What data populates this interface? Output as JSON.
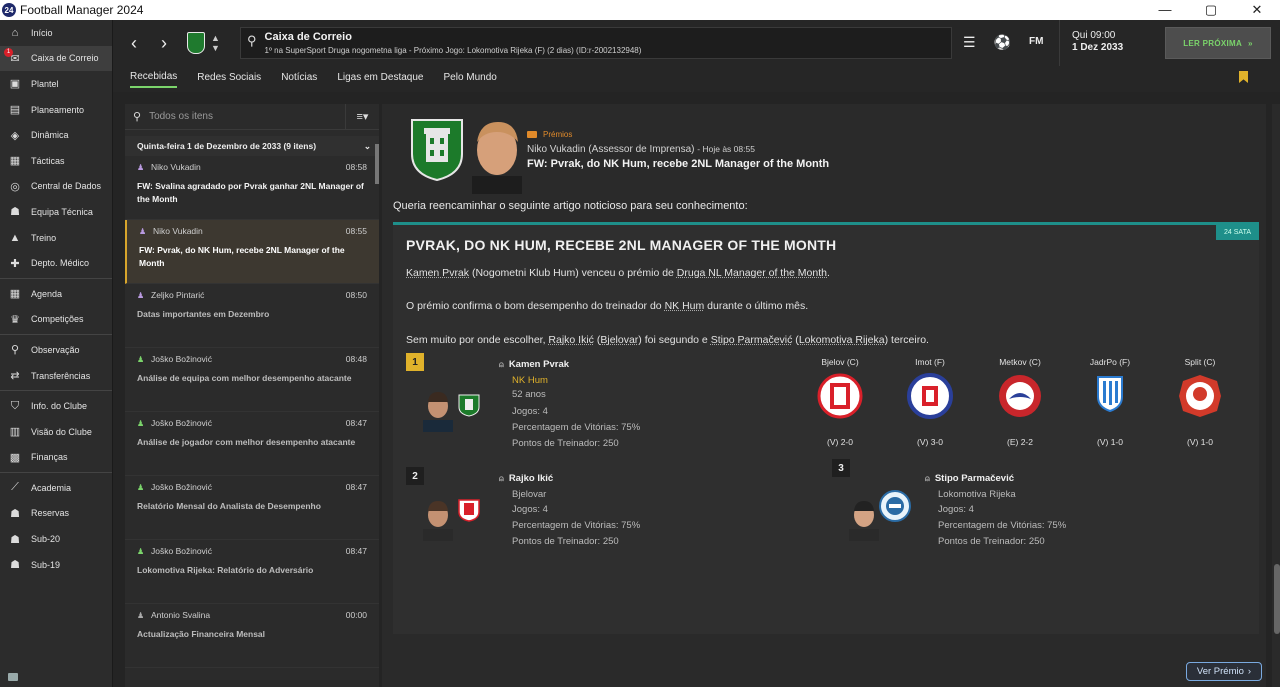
{
  "window": {
    "app_icon": "24",
    "title": "Football Manager 2024",
    "min": "—",
    "max": "▢",
    "close": "✕"
  },
  "sidebar": {
    "mail_badge": "1",
    "items": [
      {
        "label": "Início",
        "icon": "home-icon"
      },
      {
        "label": "Caixa de Correio",
        "icon": "mail-icon"
      },
      {
        "label": "Plantel",
        "icon": "shirt-icon"
      },
      {
        "label": "Planeamento",
        "icon": "clipboard-icon"
      },
      {
        "label": "Dinâmica",
        "icon": "dynamics-icon"
      },
      {
        "label": "Tácticas",
        "icon": "tactics-icon"
      },
      {
        "label": "Central de Dados",
        "icon": "data-icon"
      },
      {
        "label": "Equipa Técnica",
        "icon": "staff-icon"
      },
      {
        "label": "Treino",
        "icon": "training-icon"
      },
      {
        "label": "Depto. Médico",
        "icon": "medical-icon"
      },
      {
        "label": "Agenda",
        "icon": "calendar-icon"
      },
      {
        "label": "Competições",
        "icon": "trophy-icon"
      },
      {
        "label": "Observação",
        "icon": "scouting-icon"
      },
      {
        "label": "Transferências",
        "icon": "transfer-icon"
      },
      {
        "label": "Info. do Clube",
        "icon": "shield-icon"
      },
      {
        "label": "Visão do Clube",
        "icon": "vision-icon"
      },
      {
        "label": "Finanças",
        "icon": "finance-icon"
      },
      {
        "label": "Academia",
        "icon": "academy-icon"
      },
      {
        "label": "Reservas",
        "icon": "reserves-icon"
      },
      {
        "label": "Sub-20",
        "icon": "u20-icon"
      },
      {
        "label": "Sub-19",
        "icon": "u19-icon"
      }
    ]
  },
  "topbar": {
    "title": "Caixa de Correio",
    "subtitle": "1º na SuperSport Druga nogometna liga - Próximo Jogo: Lokomotiva Rijeka (F) (2 dias) (ID:r-2002132948)",
    "fm_label": "FM",
    "date_day": "Qui 09:00",
    "date_full": "1 Dez 2033",
    "next_button": "LER PRÓXIMA"
  },
  "tabs": [
    "Recebidas",
    "Redes Sociais",
    "Notícias",
    "Ligas em Destaque",
    "Pelo Mundo"
  ],
  "list": {
    "search_placeholder": "Todos os itens",
    "group_label": "Quinta-feira 1 de Dezembro de 2033 (9 itens)",
    "messages": [
      {
        "from": "Niko Vukadin",
        "time": "08:58",
        "subject": "FW: Svalina agradado por Pvrak ganhar 2NL Manager of the Month"
      },
      {
        "from": "Niko Vukadin",
        "time": "08:55",
        "subject": "FW: Pvrak, do NK Hum, recebe 2NL Manager of the Month"
      },
      {
        "from": "Zeljko Pintarić",
        "time": "08:50",
        "subject": "Datas importantes em Dezembro"
      },
      {
        "from": "Joško Božinović",
        "time": "08:48",
        "subject": "Análise de equipa com melhor desempenho atacante"
      },
      {
        "from": "Joško Božinović",
        "time": "08:47",
        "subject": "Análise de jogador com melhor desempenho atacante"
      },
      {
        "from": "Joško Božinović",
        "time": "08:47",
        "subject": "Relatório Mensal do Analista de Desempenho"
      },
      {
        "from": "Joško Božinović",
        "time": "08:47",
        "subject": "Lokomotiva Rijeka: Relatório do Adversário"
      },
      {
        "from": "Antonio Svalina",
        "time": "00:00",
        "subject": "Actualização Financeira Mensal"
      }
    ]
  },
  "reader": {
    "category": "Prémios",
    "sender": "Niko Vukadin",
    "sender_role": "(Assessor de Imprensa)",
    "sent_when": "- Hoje às 08:55",
    "subject": "FW: Pvrak, do NK Hum, recebe 2NL Manager of the Month",
    "intro": "Queria reencaminhar o seguinte artigo noticioso para seu conhecimento:",
    "article": {
      "date_tag": "24 SATA",
      "title": "PVRAK, DO NK HUM, RECEBE 2NL MANAGER OF THE MONTH",
      "p1_a": "Kamen Pvrak",
      "p1_b": " (Nogometni Klub Hum) venceu o prémio de ",
      "p1_c": "Druga NL Manager of the Month",
      "p1_d": ".",
      "p2_a": "O prémio confirma o bom desempenho do treinador do ",
      "p2_b": "NK Hum",
      "p2_c": " durante o último mês.",
      "p3_a": "Sem muito por onde escolher, ",
      "p3_b": "Rajko Ikić",
      "p3_c": " (",
      "p3_d": "Bjelovar",
      "p3_e": ") foi segundo e ",
      "p3_f": "Stipo Parmačević",
      "p3_g": " (",
      "p3_h": "Lokomotiva Rijeka",
      "p3_i": ") terceiro."
    },
    "winners": [
      {
        "rank": "1",
        "name": "Kamen Pvrak",
        "club": "NK Hum",
        "age": "52 anos",
        "games": "Jogos: 4",
        "winpct": "Percentagem de Vitórias: 75%",
        "points": "Pontos de Treinador: 250"
      },
      {
        "rank": "2",
        "name": "Rajko Ikić",
        "club": "Bjelovar",
        "games": "Jogos: 4",
        "winpct": "Percentagem de Vitórias: 75%",
        "points": "Pontos de Treinador: 250"
      },
      {
        "rank": "3",
        "name": "Stipo Parmačević",
        "club": "Lokomotiva Rijeka",
        "games": "Jogos: 4",
        "winpct": "Percentagem de Vitórias: 75%",
        "points": "Pontos de Treinador: 250"
      }
    ],
    "fixtures": [
      {
        "team": "Bjelov (C)",
        "result": "(V) 2-0",
        "color": "#d9202a"
      },
      {
        "team": "Imot (F)",
        "result": "(V) 3-0",
        "color": "#2a3f9a"
      },
      {
        "team": "Metkov (C)",
        "result": "(E) 2-2",
        "color": "#c8262b"
      },
      {
        "team": "JadrPo (F)",
        "result": "(V) 1-0",
        "color": "#2b7bd0"
      },
      {
        "team": "Split (C)",
        "result": "(V) 1-0",
        "color": "#d23a2a"
      }
    ],
    "footer_button": "Ver Prémio"
  }
}
